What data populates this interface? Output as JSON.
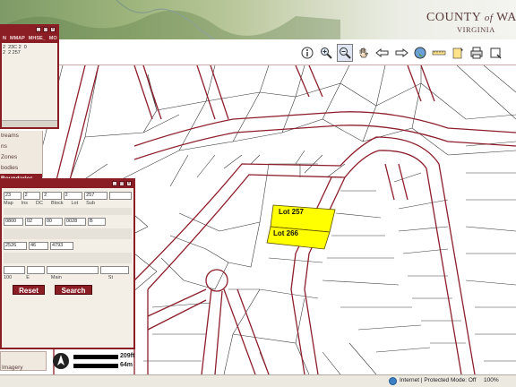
{
  "header": {
    "title_prefix": "COUNTY",
    "title_of": "of",
    "title_suffix": "WA",
    "subtitle": "VIRGINIA"
  },
  "toolbar": {
    "tools": [
      "identify-icon",
      "zoom-in-icon",
      "zoom-out-icon",
      "pan-icon",
      "back-icon",
      "forward-icon",
      "full-extent-icon",
      "measure-icon",
      "select-icon",
      "print-icon",
      "clear-icon"
    ],
    "active": "zoom-out-icon"
  },
  "attribute_panel": {
    "columns": [
      "N",
      "MMAP",
      "MHSE_",
      "MO"
    ],
    "row": [
      "2\n2",
      "23C 2\n2 257",
      "0",
      ""
    ]
  },
  "layers": {
    "items": [
      "treams",
      "ns",
      "Zones",
      "bodies",
      "Boundaries"
    ],
    "selected": "Boundaries"
  },
  "search_panel": {
    "row1_values": [
      "23",
      "2",
      "2",
      "2",
      "257"
    ],
    "row1_labels": [
      "Map",
      "Ins",
      "DC",
      "Block",
      "Lot",
      "Sub"
    ],
    "row2_values": [
      "0800",
      "02",
      "00",
      "0028",
      "B"
    ],
    "row3_values": [
      "2526",
      "46",
      "4793"
    ],
    "row4_labels": [
      "100",
      "E",
      "Main",
      "St"
    ],
    "reset_label": "Reset",
    "search_label": "Search"
  },
  "imagery": {
    "item": "Imagery"
  },
  "map": {
    "lots": [
      {
        "label": "Lot 257",
        "color": "#ffff00"
      },
      {
        "label": "Lot 266",
        "color": "#ffff00"
      }
    ],
    "road_color": "#8d1e2b"
  },
  "scale": {
    "feet": "209ft",
    "meters": "64m"
  },
  "status": {
    "text": "Internet | Protected Mode: Off",
    "zoom": "100%"
  }
}
